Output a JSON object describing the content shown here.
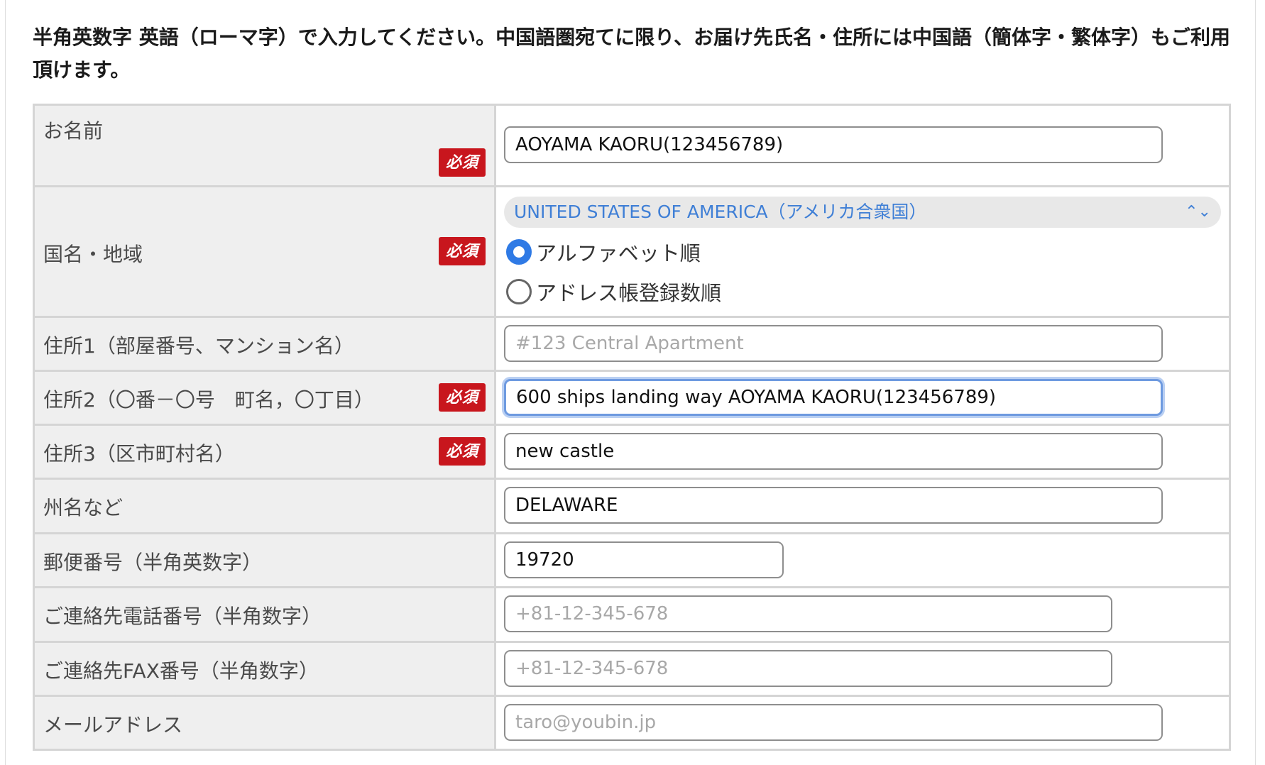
{
  "instructions": "半角英数字 英語（ローマ字）で入力してください。中国語圏宛てに限り、お届け先氏名・住所には中国語（簡体字・繁体字）もご利用頂けます。",
  "required_label": "必須",
  "rows": {
    "name": {
      "label": "お名前",
      "value": "AOYAMA KAORU(123456789)",
      "required": true
    },
    "country": {
      "label": "国名・地域",
      "selected": "UNITED STATES OF AMERICA（アメリカ合衆国）",
      "required": true,
      "sort_options": [
        {
          "label": "アルファベット順",
          "checked": true
        },
        {
          "label": "アドレス帳登録数順",
          "checked": false
        }
      ]
    },
    "address1": {
      "label": "住所1（部屋番号、マンション名）",
      "value": "",
      "placeholder": "#123 Central Apartment",
      "required": false
    },
    "address2": {
      "label": "住所2（〇番－〇号　町名，〇丁目）",
      "value": "600 ships landing way AOYAMA KAORU(123456789)",
      "required": true
    },
    "address3": {
      "label": "住所3（区市町村名）",
      "value": "new castle",
      "required": true
    },
    "state": {
      "label": "州名など",
      "value": "DELAWARE",
      "required": false
    },
    "postal": {
      "label": "郵便番号（半角英数字）",
      "value": "19720",
      "required": false
    },
    "phone": {
      "label": "ご連絡先電話番号（半角数字）",
      "value": "",
      "placeholder": "+81-12-345-678",
      "required": false
    },
    "fax": {
      "label": "ご連絡先FAX番号（半角数字）",
      "value": "",
      "placeholder": "+81-12-345-678",
      "required": false
    },
    "email": {
      "label": "メールアドレス",
      "value": "",
      "placeholder": "taro@youbin.jp",
      "required": false
    }
  },
  "colors": {
    "required_badge": "#c8161d",
    "select_text": "#3f7fd6",
    "radio_checked": "#2f7ae5",
    "focus_ring": "#6e9ae0"
  }
}
